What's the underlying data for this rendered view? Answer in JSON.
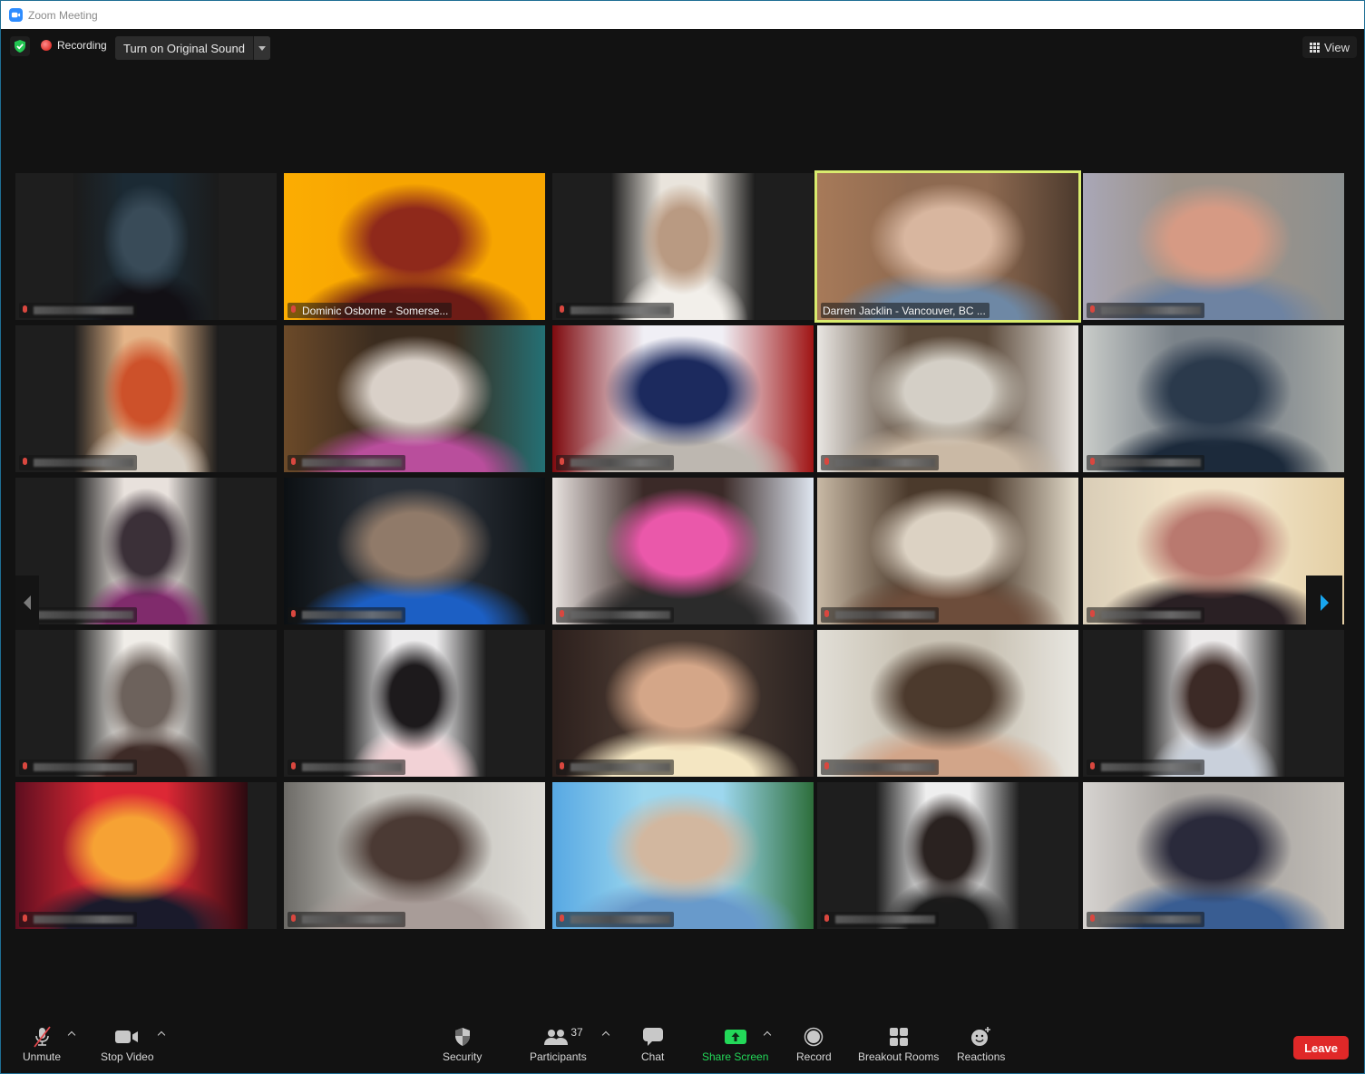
{
  "window": {
    "title": "Zoom Meeting",
    "app_icon": "zoom-camera-icon"
  },
  "topbar": {
    "security_badge_icon": "shield-check-icon",
    "recording_label": "Recording",
    "original_sound_label": "Turn on Original Sound",
    "view_label": "View"
  },
  "gallery": {
    "active_speaker_color": "#d9ec6e",
    "tiles": [
      {
        "name": "",
        "muted": true,
        "active": false,
        "colors": [
          "#1b1b1b",
          "#1c2a33",
          "#3a4b57",
          "#121015",
          "#1b1b1b"
        ],
        "video_ratio": "portrait"
      },
      {
        "name": "Dominic Osborne - Somerse...",
        "muted": true,
        "active": false,
        "colors": [
          "#f8ad0a",
          "#f3a509",
          "#8b2a1d",
          "#6a1d17",
          "#f3a509"
        ],
        "video_ratio": "full"
      },
      {
        "name": "",
        "muted": true,
        "active": false,
        "colors": [
          "#1b1b1b",
          "#e9e4dc",
          "#b89a83",
          "#f2efea",
          "#1b1b1b"
        ],
        "video_ratio": "portrait"
      },
      {
        "name": "Darren Jacklin - Vancouver, BC ...",
        "muted": false,
        "active": true,
        "colors": [
          "#a57a5b",
          "#8d6a52",
          "#d7b6a0",
          "#6f88a3",
          "#4b3a2e"
        ],
        "video_ratio": "full"
      },
      {
        "name": "",
        "muted": true,
        "active": false,
        "colors": [
          "#a9a7b6",
          "#9c9289",
          "#d49b86",
          "#6f83a0",
          "#8b9090"
        ],
        "video_ratio": "full"
      },
      {
        "name": "",
        "muted": true,
        "active": false,
        "colors": [
          "#1b1b1b",
          "#e2b48a",
          "#c8522d",
          "#d8d0c6",
          "#1b1b1b"
        ],
        "video_ratio": "portrait"
      },
      {
        "name": "",
        "muted": true,
        "active": false,
        "colors": [
          "#6b4a2b",
          "#3a2c20",
          "#d9d0c8",
          "#b54f9a",
          "#276f73"
        ],
        "video_ratio": "full"
      },
      {
        "name": "",
        "muted": true,
        "active": false,
        "colors": [
          "#7a0b0f",
          "#f0eff5",
          "#1d2a5c",
          "#bdb7b0",
          "#9a1515"
        ],
        "video_ratio": "full"
      },
      {
        "name": "",
        "muted": true,
        "active": false,
        "colors": [
          "#e9e6e2",
          "#5a4a3c",
          "#d4cfc6",
          "#c9b9a6",
          "#ebe7e2"
        ],
        "video_ratio": "full"
      },
      {
        "name": "",
        "muted": true,
        "active": false,
        "colors": [
          "#c9ccc9",
          "#7a8289",
          "#2c3a4b",
          "#1d2a3a",
          "#a9aca8"
        ],
        "video_ratio": "full"
      },
      {
        "name": "",
        "muted": true,
        "active": false,
        "colors": [
          "#1b1b1b",
          "#e8e1dc",
          "#3b3038",
          "#7d2c6a",
          "#1b1b1b"
        ],
        "video_ratio": "portrait"
      },
      {
        "name": "",
        "muted": true,
        "active": false,
        "colors": [
          "#0c1013",
          "#2a3038",
          "#8f7a6a",
          "#1f5fbf",
          "#0c1013"
        ],
        "video_ratio": "full"
      },
      {
        "name": "",
        "muted": true,
        "active": false,
        "colors": [
          "#e9e3e0",
          "#3a2a28",
          "#e55aa8",
          "#2b2b2b",
          "#dfe6f0"
        ],
        "video_ratio": "full"
      },
      {
        "name": "",
        "muted": true,
        "active": false,
        "colors": [
          "#c7b9a6",
          "#4a3a2d",
          "#dcd2c4",
          "#6c4d3c",
          "#e7dfcf"
        ],
        "video_ratio": "full"
      },
      {
        "name": "",
        "muted": true,
        "active": false,
        "colors": [
          "#d8cdb8",
          "#efe2c8",
          "#b77a70",
          "#2a2024",
          "#e3cfa6"
        ],
        "video_ratio": "full"
      },
      {
        "name": "",
        "muted": true,
        "active": false,
        "colors": [
          "#1b1b1b",
          "#f0ede8",
          "#6d625c",
          "#3d2b27",
          "#1b1b1b"
        ],
        "video_ratio": "portrait"
      },
      {
        "name": "",
        "muted": true,
        "active": false,
        "colors": [
          "#1b1b1b",
          "#ecebec",
          "#1d1a1c",
          "#f1d2d6",
          "#1b1b1b"
        ],
        "video_ratio": "portrait"
      },
      {
        "name": "",
        "muted": true,
        "active": false,
        "colors": [
          "#2b1f1c",
          "#4a3b33",
          "#d2a68a",
          "#f3e6c4",
          "#2a2220"
        ],
        "video_ratio": "full"
      },
      {
        "name": "",
        "muted": true,
        "active": false,
        "colors": [
          "#e1ded6",
          "#c8c1b4",
          "#4b3a2e",
          "#d0a58b",
          "#e9e7e1"
        ],
        "video_ratio": "full"
      },
      {
        "name": "",
        "muted": true,
        "active": false,
        "colors": [
          "#1b1b1b",
          "#eceaea",
          "#3b2a26",
          "#c9d0da",
          "#1b1b1b"
        ],
        "video_ratio": "portrait"
      },
      {
        "name": "",
        "muted": true,
        "active": false,
        "colors": [
          "#5a0f1f",
          "#d62a36",
          "#f2a23a",
          "#1a1a2a",
          "#2a0a10"
        ],
        "video_ratio": "portrait-wide"
      },
      {
        "name": "",
        "muted": true,
        "active": false,
        "colors": [
          "#6c6a66",
          "#c8c6c0",
          "#4a3a34",
          "#a89c98",
          "#dedcd7"
        ],
        "video_ratio": "full"
      },
      {
        "name": "",
        "muted": true,
        "active": false,
        "colors": [
          "#5aa7e0",
          "#9fd6ec",
          "#d1b7a0",
          "#6a9ac8",
          "#2f6d3c"
        ],
        "video_ratio": "full"
      },
      {
        "name": "",
        "muted": true,
        "active": false,
        "colors": [
          "#1b1b1b",
          "#eeeeee",
          "#2a2220",
          "#1a1a1a",
          "#1b1b1b"
        ],
        "video_ratio": "portrait"
      },
      {
        "name": "",
        "muted": true,
        "active": false,
        "colors": [
          "#d6d3d0",
          "#a9a5a1",
          "#2a2a3a",
          "#3b5d8f",
          "#c3bfb9"
        ],
        "video_ratio": "full"
      }
    ],
    "nav_prev_icon": "chevron-left-icon",
    "nav_next_icon": "chevron-right-icon"
  },
  "toolbar": {
    "unmute_label": "Unmute",
    "stop_video_label": "Stop Video",
    "security_label": "Security",
    "participants_label": "Participants",
    "participants_count": "37",
    "chat_label": "Chat",
    "share_screen_label": "Share Screen",
    "record_label": "Record",
    "breakout_rooms_label": "Breakout Rooms",
    "reactions_label": "Reactions",
    "leave_label": "Leave",
    "share_color": "#23d959",
    "leave_color": "#e02828"
  }
}
